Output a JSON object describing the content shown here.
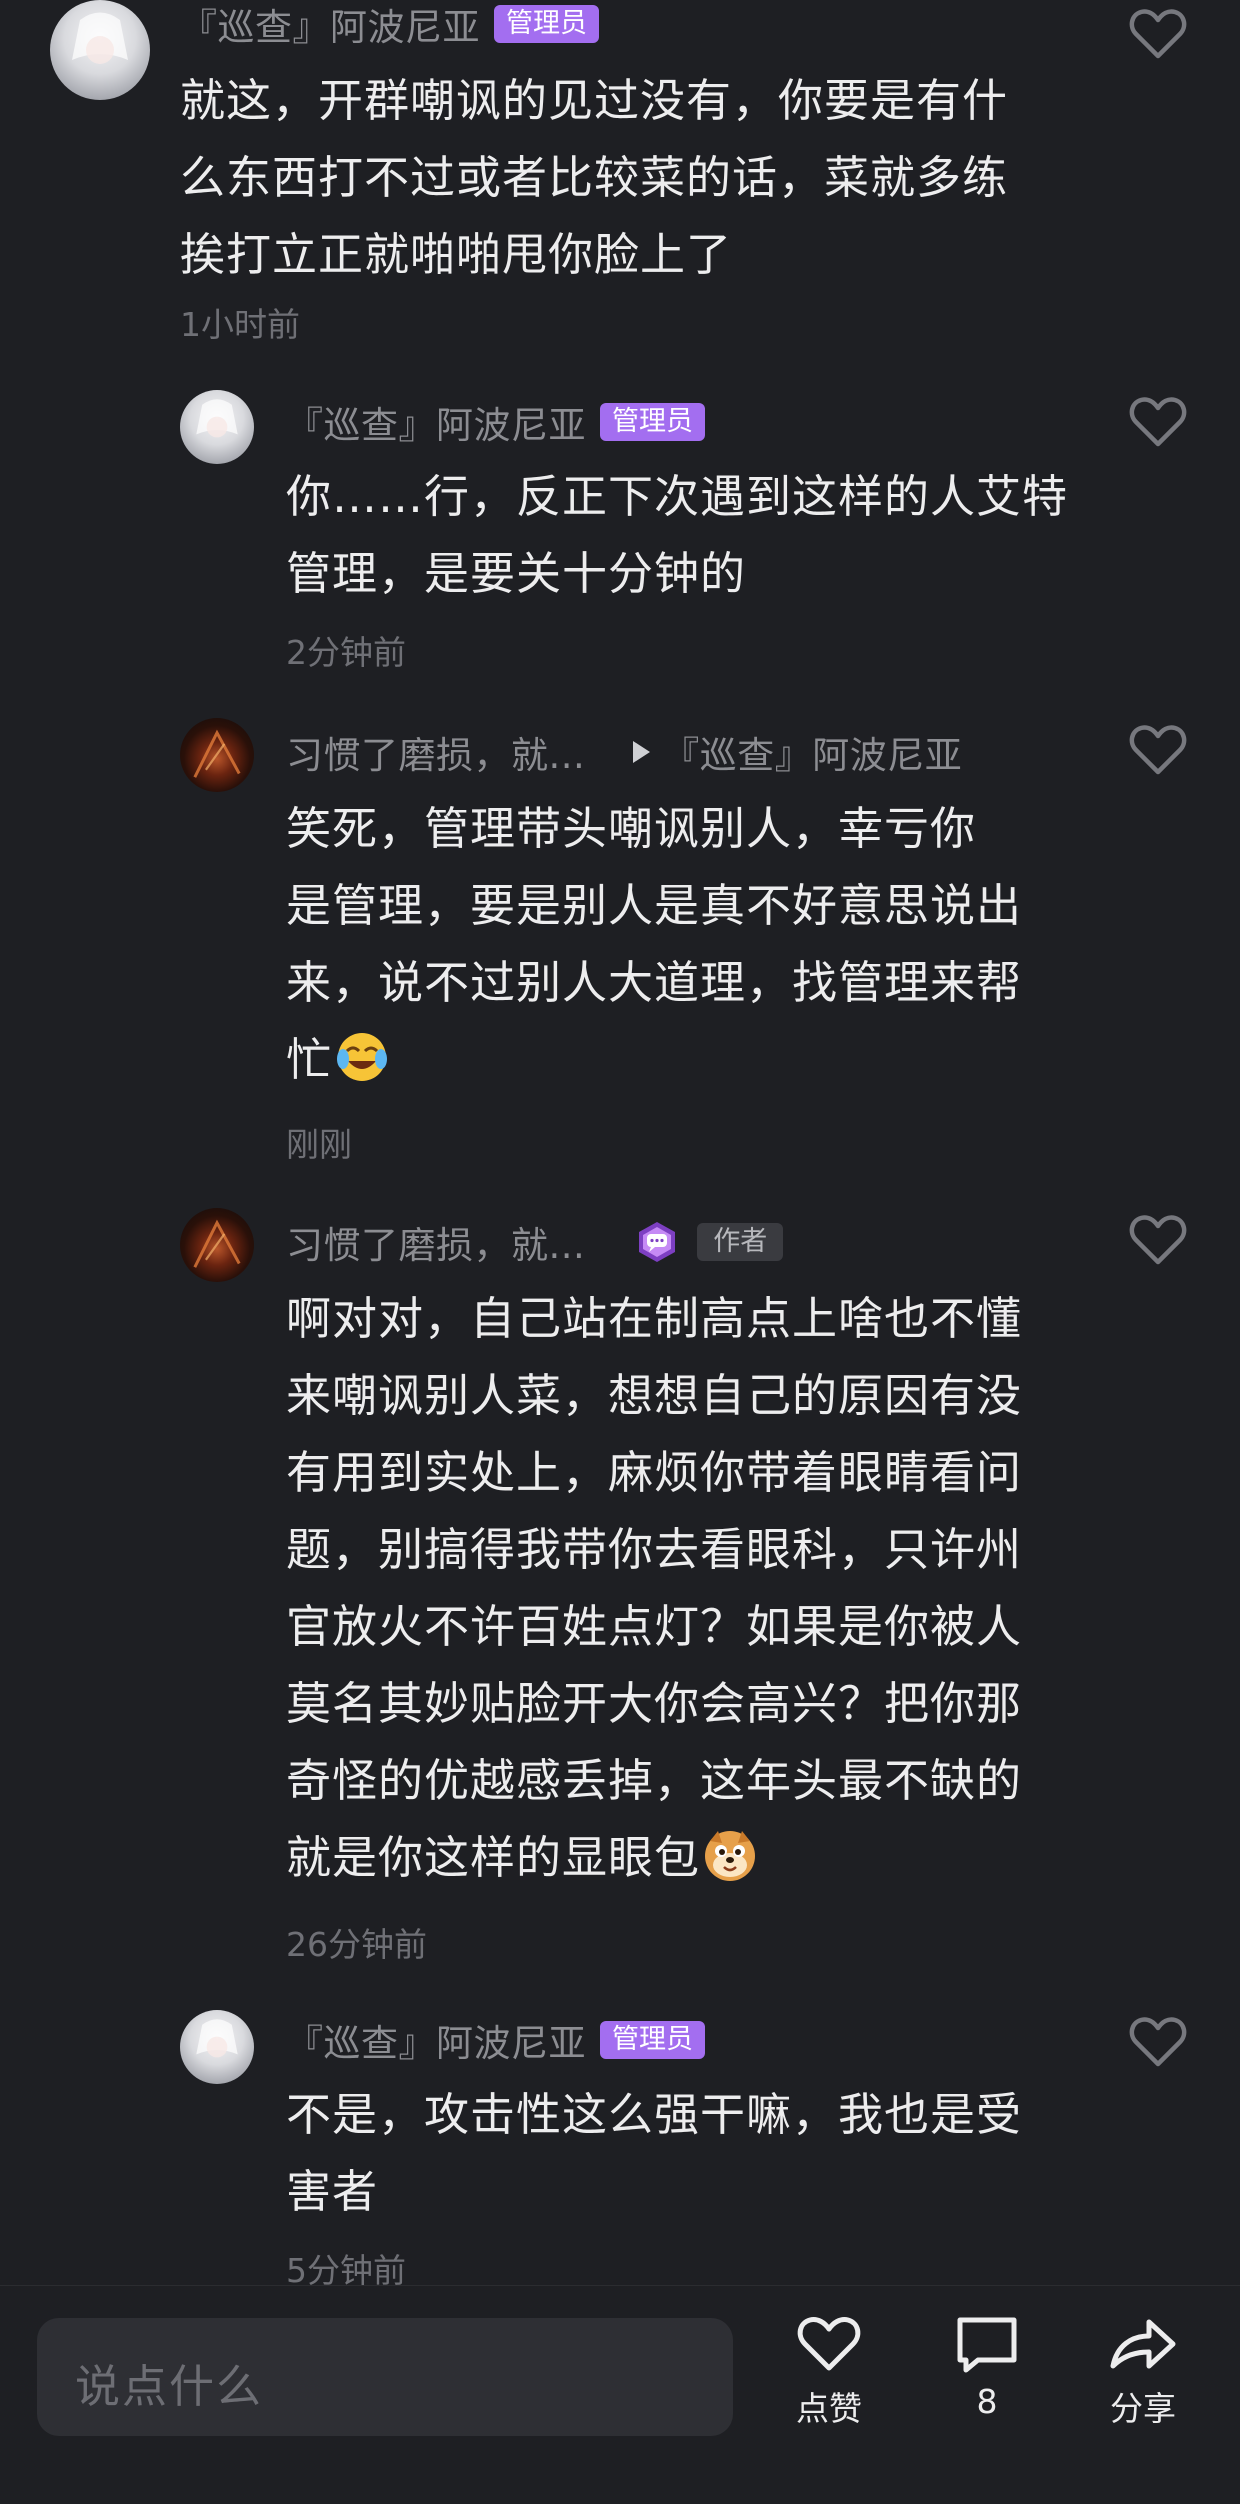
{
  "comments": [
    {
      "name": "『巡查』阿波尼亚",
      "badge": "管理员",
      "lines": [
        "就这，开群嘲讽的见过没有，你要是有什",
        "么东西打不过或者比较菜的话，菜就多练",
        "挨打立正就啪啪甩你脸上了"
      ],
      "time": "1小时前"
    },
    {
      "name": "『巡查』阿波尼亚",
      "badge": "管理员",
      "lines": [
        "你……行，反正下次遇到这样的人艾特",
        "管理，是要关十分钟的"
      ],
      "time": "2分钟前"
    },
    {
      "name": "习惯了磨损，就...",
      "reply_to": "『巡查』阿波尼亚",
      "lines": [
        "笑死，管理带头嘲讽别人，幸亏你",
        "是管理，要是别人是真不好意思说出",
        "来，说不过别人大道理，找管理来帮",
        "忙"
      ],
      "emoji": "face-with-tears-of-joy",
      "time": "刚刚"
    },
    {
      "name": "习惯了磨损，就...",
      "badge": "作者",
      "lines": [
        "啊对对，自己站在制高点上啥也不懂",
        "来嘲讽别人菜，想想自己的原因有没",
        "有用到实处上，麻烦你带着眼睛看问",
        "题，别搞得我带你去看眼科，只许州",
        "官放火不许百姓点灯？如果是你被人",
        "莫名其妙贴脸开大你会高兴？把你那",
        "奇怪的优越感丢掉，这年头最不缺的",
        "就是你这样的显眼包"
      ],
      "emoji": "doge-sticker",
      "time": "26分钟前"
    },
    {
      "name": "『巡查』阿波尼亚",
      "badge": "管理员",
      "lines": [
        "不是，攻击性这么强干嘛，我也是受",
        "害者"
      ],
      "time": "5分钟前"
    }
  ],
  "bottom_bar": {
    "placeholder": "说点什么",
    "like_label": "点赞",
    "comment_count": "8",
    "share_label": "分享"
  },
  "colors": {
    "background": "#1e1f23",
    "admin_badge": "#a36ef0",
    "username": "#8c8d92",
    "timestamp": "#6f7076"
  }
}
